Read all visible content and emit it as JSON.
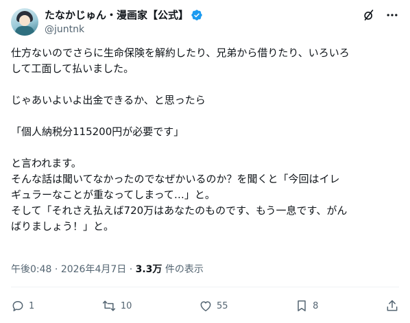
{
  "author": {
    "display_name": "たなかじゅん・漫画家【公式】",
    "handle": "@juntnk",
    "verified_color": "#1d9bf0"
  },
  "header_icons": [
    "grok-icon",
    "more-icon"
  ],
  "tweet": {
    "paragraphs": [
      "仕方ないのでさらに生命保険を解約したり、兄弟から借りたり、いろいろ\nして工面して払いました。",
      "じゃあいよいよ出金できるか、と思ったら",
      "「個人納税分115200円が必要です」",
      "と言われます。\nそんな話は聞いてなかったのでなぜかいるのか？を聞くと「今回はイレ\nギュラーなことが重なってしまって…」と。\nそして「それさえ払えば720万はあなたのものです、もう一息です、がん\nばりましょう！」と。"
    ]
  },
  "meta": {
    "time": "午後0:48",
    "sep1": " · ",
    "date": "2026年4月7日",
    "sep2": " · ",
    "views_count": "3.3万",
    "views_label": " 件の表示"
  },
  "actions": {
    "reply_count": "1",
    "retweet_count": "10",
    "like_count": "55",
    "bookmark_count": "8"
  },
  "colors": {
    "text": "#0f1419",
    "secondary": "#536471",
    "divider": "#eff3f4",
    "accent": "#1d9bf0"
  }
}
